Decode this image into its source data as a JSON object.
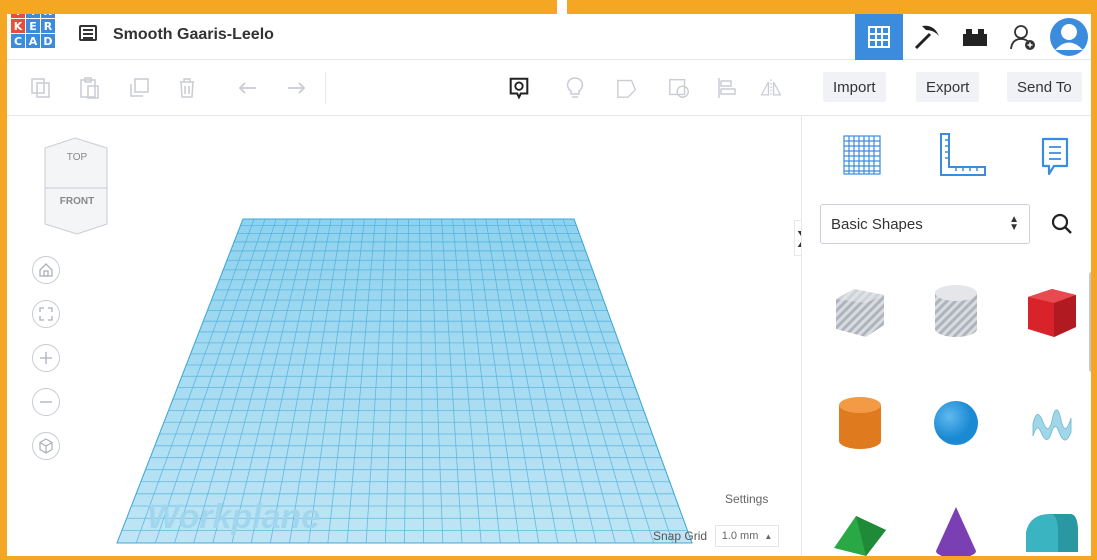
{
  "app": {
    "logo_letters": [
      "T",
      "I",
      "N",
      "K",
      "E",
      "R",
      "C",
      "A",
      "D"
    ],
    "logo_colors": [
      "#e84d3b",
      "#3c8cde",
      "#3c8cde",
      "#e84d3b",
      "#3c8cde",
      "#3c8cde",
      "#3c8cde",
      "#3c8cde",
      "#3c8cde"
    ],
    "design_title": "Smooth Gaaris-Leelo"
  },
  "titlebar": {
    "views": [
      {
        "name": "3d-design-view",
        "icon": "grid-icon",
        "active": true
      },
      {
        "name": "blocks-view",
        "icon": "pickaxe-icon",
        "active": false
      },
      {
        "name": "bricks-view",
        "icon": "brick-icon",
        "active": false
      }
    ],
    "user_icons": [
      "add-user-icon",
      "avatar-icon"
    ]
  },
  "toolbar": {
    "tools": [
      "copy-icon",
      "paste-icon",
      "duplicate-icon",
      "delete-icon",
      "undo-icon",
      "redo-icon"
    ],
    "right_tools": [
      "notes-icon",
      "light-bulb-icon",
      "shape-hole-icon",
      "group-icon",
      "align-icon",
      "mirror-icon"
    ],
    "import_label": "Import",
    "export_label": "Export",
    "send_to_label": "Send To"
  },
  "viewport": {
    "cube_top": "TOP",
    "cube_front": "FRONT",
    "nav": [
      "home-icon",
      "fit-view-icon",
      "zoom-in-icon",
      "zoom-out-icon",
      "ortho-view-icon"
    ],
    "workplane_label": "Workplane",
    "settings_label": "Settings",
    "snap_grid_label": "Snap Grid",
    "snap_grid_value": "1.0 mm"
  },
  "panel": {
    "tabs": [
      "workplane-icon",
      "ruler-icon",
      "notes-icon"
    ],
    "category": "Basic Shapes",
    "shapes": [
      {
        "name": "box-hole",
        "color": "#b8bcc4"
      },
      {
        "name": "cylinder-hole",
        "color": "#b8bcc4"
      },
      {
        "name": "box",
        "color": "#d8232a"
      },
      {
        "name": "cylinder",
        "color": "#e07a1f"
      },
      {
        "name": "sphere",
        "color": "#1b8ad3"
      },
      {
        "name": "scribble",
        "color": "#9fd7e8"
      },
      {
        "name": "roof",
        "color": "#2aa845"
      },
      {
        "name": "cone",
        "color": "#7b3fb4"
      },
      {
        "name": "round-roof",
        "color": "#3bb4c1"
      }
    ]
  }
}
